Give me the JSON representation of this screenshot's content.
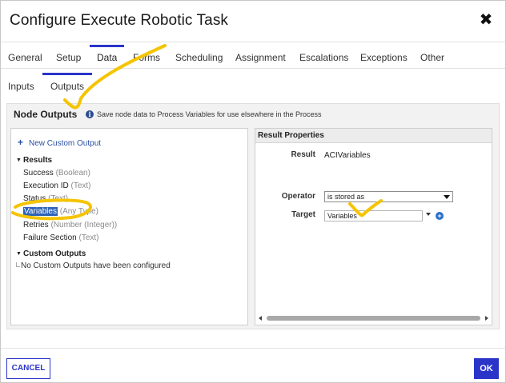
{
  "dialog": {
    "title": "Configure Execute Robotic Task",
    "close_glyph": "✖"
  },
  "tabs": [
    {
      "label": "General",
      "active": false
    },
    {
      "label": "Setup",
      "active": false
    },
    {
      "label": "Data",
      "active": true
    },
    {
      "label": "Forms",
      "active": false
    },
    {
      "label": "Scheduling",
      "active": false
    },
    {
      "label": "Assignment",
      "active": false
    },
    {
      "label": "Escalations",
      "active": false
    },
    {
      "label": "Exceptions",
      "active": false
    },
    {
      "label": "Other",
      "active": false
    }
  ],
  "subtabs": [
    {
      "label": "Inputs",
      "active": false
    },
    {
      "label": "Outputs",
      "active": true
    }
  ],
  "node_outputs": {
    "heading": "Node Outputs",
    "info_glyph": "i",
    "info_text": "Save node data to Process Variables for use elsewhere in the Process",
    "new_custom_output": "New Custom Output",
    "results_group": "Results",
    "results": [
      {
        "name": "Success",
        "type": "(Boolean)",
        "selected": false
      },
      {
        "name": "Execution ID",
        "type": "(Text)",
        "selected": false
      },
      {
        "name": "Status",
        "type": "(Text)",
        "selected": false
      },
      {
        "name": "Variables",
        "type": "(Any Type)",
        "selected": true
      },
      {
        "name": "Retries",
        "type": "(Number (Integer))",
        "selected": false
      },
      {
        "name": "Failure Section",
        "type": "(Text)",
        "selected": false
      }
    ],
    "custom_group": "Custom Outputs",
    "custom_empty": "No Custom Outputs have been configured"
  },
  "result_properties": {
    "heading": "Result Properties",
    "result_label": "Result",
    "result_value": "ACIVariables",
    "operator_label": "Operator",
    "operator_value": "is stored as",
    "target_label": "Target",
    "target_value": "Variables"
  },
  "footer": {
    "cancel_label": "CANCEL",
    "ok_label": "OK"
  },
  "colors": {
    "accent": "#2b34c9",
    "link": "#2a4fa1",
    "selection": "#2d63b8",
    "highlighter": "#f5c400"
  }
}
